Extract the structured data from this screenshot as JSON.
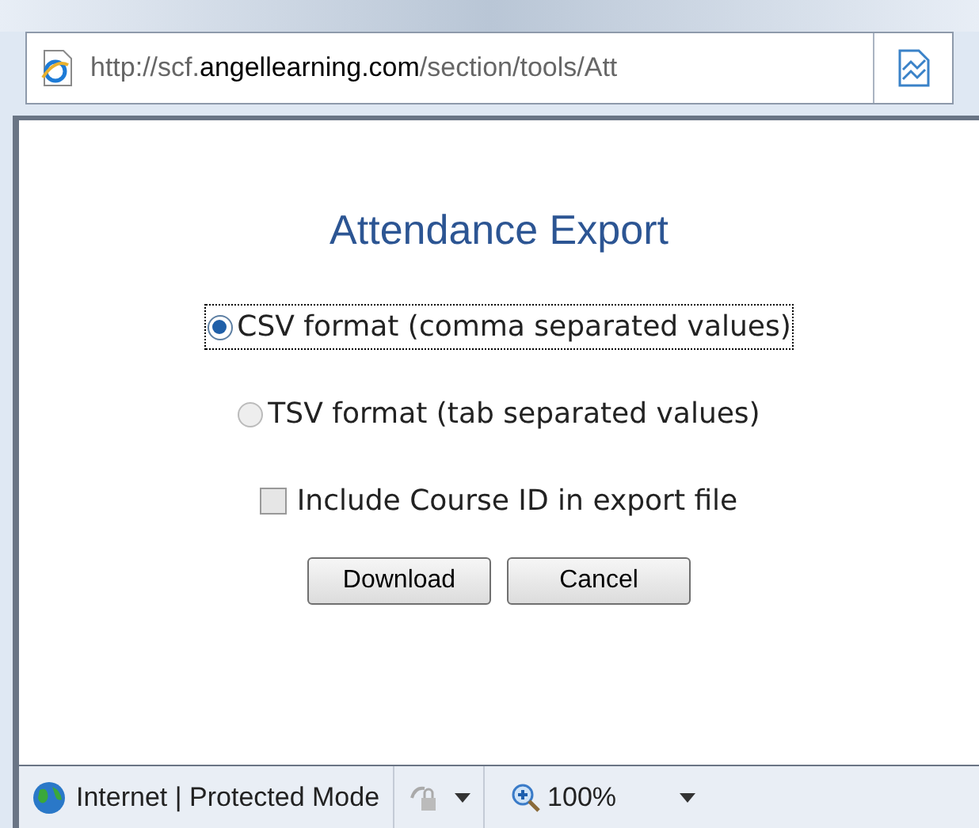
{
  "address_bar": {
    "url": "http://scf.**angellearning.com**/section/tools/Att"
  },
  "dialog": {
    "title": "Attendance Export",
    "formats": [
      {
        "label": "CSV format (comma separated values)",
        "selected": true,
        "focused": true
      },
      {
        "label": "TSV format (tab separated values)",
        "selected": false,
        "focused": false
      }
    ],
    "include_course_id": {
      "label": "Include Course ID in export file",
      "checked": false
    },
    "buttons": [
      "Download",
      "Cancel"
    ]
  },
  "status_bar": {
    "zone": "Internet | Protected Mode",
    "zoom": "100%"
  }
}
